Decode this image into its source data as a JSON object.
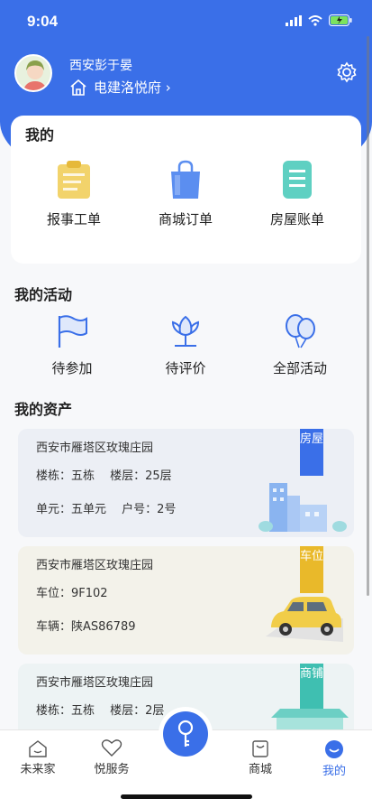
{
  "status": {
    "time": "9:04"
  },
  "profile": {
    "name": "西安彭于晏",
    "community": "电建洛悦府 ›"
  },
  "mine": {
    "title": "我的",
    "items": [
      {
        "label": "报事工单",
        "icon": "clipboard-icon"
      },
      {
        "label": "商城订单",
        "icon": "shopping-bag-icon"
      },
      {
        "label": "房屋账单",
        "icon": "bill-icon"
      }
    ]
  },
  "activities": {
    "title": "我的活动",
    "items": [
      {
        "label": "待参加",
        "icon": "flag-icon"
      },
      {
        "label": "待评价",
        "icon": "flower-icon"
      },
      {
        "label": "全部活动",
        "icon": "balloon-icon"
      }
    ]
  },
  "assets": {
    "title": "我的资产",
    "cards": [
      {
        "address": "西安市雁塔区玫瑰庄园",
        "line1": "楼栋：五栋　 楼层：25层",
        "line2": "单元：五单元　 户号：2号",
        "tag": "房屋",
        "color": "#3a6fe8",
        "bg": "#eceff5"
      },
      {
        "address": "西安市雁塔区玫瑰庄园",
        "line1": "车位：9F102",
        "line2": "车辆：陕AS86789",
        "tag": "车位",
        "color": "#e9b92a",
        "bg": "#f3f2ea"
      },
      {
        "address": "西安市雁塔区玫瑰庄园",
        "line1": "楼栋：五栋　 楼层：2层",
        "line2": "",
        "tag": "商铺",
        "color": "#3fbfb1",
        "bg": "#edf3f4"
      }
    ]
  },
  "nav": {
    "items": [
      {
        "label": "未来家",
        "icon": "home-icon"
      },
      {
        "label": "悦服务",
        "icon": "heart-icon"
      },
      {
        "label": "商城",
        "icon": "shop-icon"
      },
      {
        "label": "我的",
        "icon": "profile-icon"
      }
    ],
    "active_color": "#3a6fe8"
  }
}
